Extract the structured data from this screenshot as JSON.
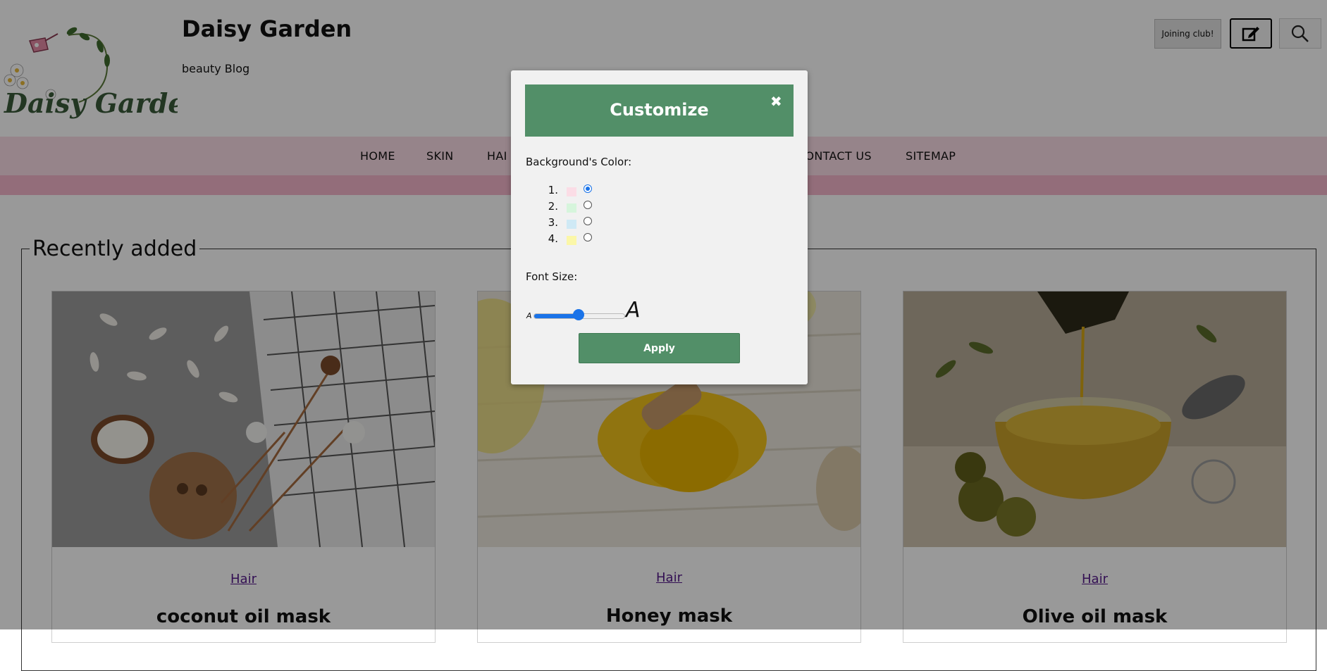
{
  "header": {
    "site_title": "Daisy Garden",
    "tagline": "beauty Blog",
    "logo_text": "Daisy Garden",
    "join_button": "Joining club!",
    "edit_icon": "edit-icon",
    "search_icon": "search-icon"
  },
  "nav": {
    "items": [
      {
        "label": "HOME"
      },
      {
        "label": "SKIN"
      },
      {
        "label": "HAI"
      },
      {
        "label": "CONTACT US"
      },
      {
        "label": "SITEMAP"
      }
    ]
  },
  "section": {
    "legend": "Recently added"
  },
  "cards": [
    {
      "category": "Hair",
      "title": "coconut oil mask"
    },
    {
      "category": "Hair",
      "title": "Honey mask"
    },
    {
      "category": "Hair",
      "title": "Olive oil mask"
    }
  ],
  "modal": {
    "title": "Customize",
    "close_icon": "close-icon",
    "bg_label": "Background's Color:",
    "colors": [
      {
        "num": "1.",
        "color": "#fbdde6",
        "selected": true
      },
      {
        "num": "2.",
        "color": "#d6f5dc",
        "selected": false
      },
      {
        "num": "3.",
        "color": "#cfe9f5",
        "selected": false
      },
      {
        "num": "4.",
        "color": "#fbf7a8",
        "selected": false
      }
    ],
    "font_label": "Font Size:",
    "slider_small": "A",
    "slider_big": "A",
    "slider_fraction": 0.5,
    "apply_label": "Apply"
  },
  "colors": {
    "accent": "#528f68",
    "nav_bg": "#fbdde6",
    "nav_strip": "#f5b6cb",
    "link": "#551a8b"
  }
}
